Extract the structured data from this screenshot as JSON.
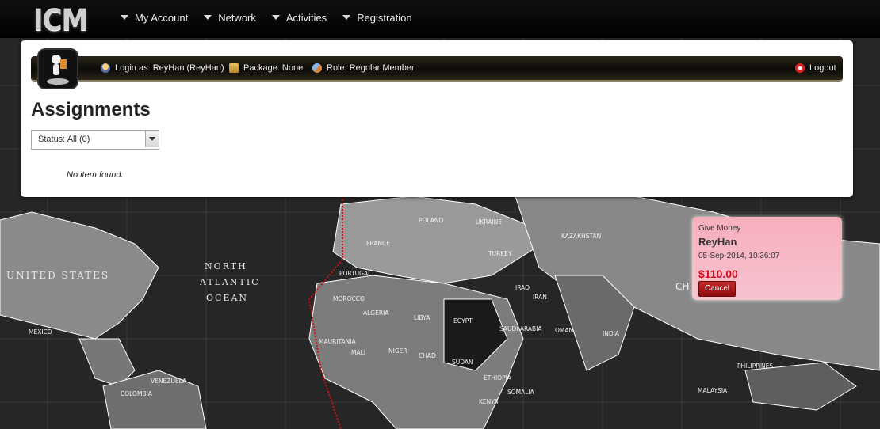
{
  "logo": {
    "text": "ICM"
  },
  "nav": {
    "items": [
      {
        "label": "My Account"
      },
      {
        "label": "Network"
      },
      {
        "label": "Activities"
      },
      {
        "label": "Registration"
      }
    ]
  },
  "userbar": {
    "login": "Login as: ReyHan (ReyHan)",
    "package": "Package: None",
    "role": "Role: Regular Member",
    "logout": "Logout"
  },
  "page": {
    "title": "Assignments",
    "status_filter": "Status: All (0)",
    "empty_message": "No item found."
  },
  "notification": {
    "type": "Give Money",
    "name": "ReyHan",
    "date": "05-Sep-2014, 10:36:07",
    "amount": "$110.00",
    "cancel_label": "Cancel"
  },
  "map_labels": {
    "north_atlantic": [
      "NORTH",
      "ATLANTIC",
      "OCEAN"
    ],
    "united_states": "UNITED STATES",
    "countries": [
      "MEXICO",
      "POLAND",
      "UKRAINE",
      "KAZAKHSTAN",
      "FRANCE",
      "TURKEY",
      "ALGERIA",
      "LIBYA",
      "EGYPT",
      "IRAN",
      "SAUDI ARABIA",
      "MALI",
      "NIGER",
      "CHAD",
      "SUDAN",
      "ETHIOPIA",
      "SOMALIA",
      "KENYA",
      "INDIA",
      "PHILIPPINES",
      "MALAYSIA",
      "COLOMBIA",
      "VENEZUELA",
      "MAURITANIA",
      "MOROCCO",
      "PORTUGAL",
      "IRAQ",
      "OMAN",
      "CH"
    ]
  },
  "colors": {
    "toast_bg": "#f7aebd",
    "amount": "#d0101a",
    "cancel_bg": "#a51818"
  }
}
